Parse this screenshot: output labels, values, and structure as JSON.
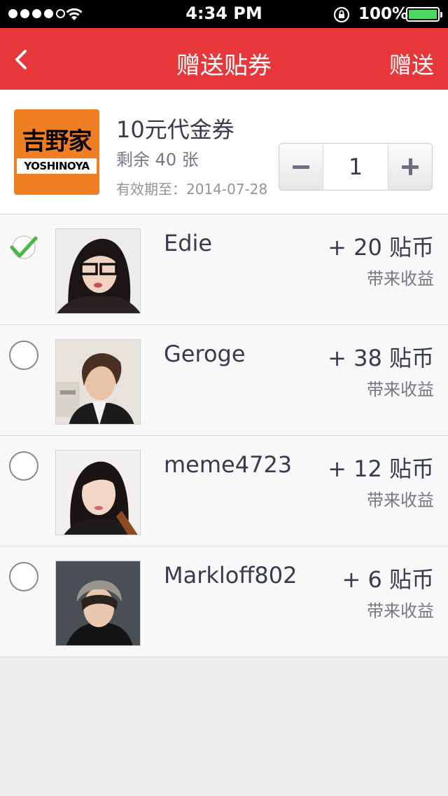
{
  "status_bar": {
    "time": "4:34 PM",
    "battery_pct": "100%",
    "signal_bars_filled": 4,
    "signal_bars_total": 5
  },
  "nav": {
    "title": "赠送贴券",
    "action_label": "赠送",
    "back_icon": "chevron-left-icon",
    "background": "#e8373b"
  },
  "coupon": {
    "logo_text": "吉野家",
    "logo_brand": "YOSHINOYA",
    "name": "10元代金券",
    "remaining": "剩余 40 张",
    "expiry": "有效期至：2014-07-28",
    "quantity": "1"
  },
  "friends": [
    {
      "name": "Edie",
      "coins": "+ 20 贴币",
      "earn": "带来收益",
      "selected": true
    },
    {
      "name": "Geroge",
      "coins": "+ 38 贴币",
      "earn": "带来收益",
      "selected": false
    },
    {
      "name": "meme4723",
      "coins": "+ 12 贴币",
      "earn": "带来收益",
      "selected": false
    },
    {
      "name": "Markloff802",
      "coins": "+ 6 贴币",
      "earn": "带来收益",
      "selected": false
    }
  ],
  "colors": {
    "accent": "#e8373b",
    "text_primary": "#383a4e",
    "text_secondary": "#767786",
    "text_tertiary": "#939498",
    "background": "#ededed",
    "check": "#4cb648"
  }
}
